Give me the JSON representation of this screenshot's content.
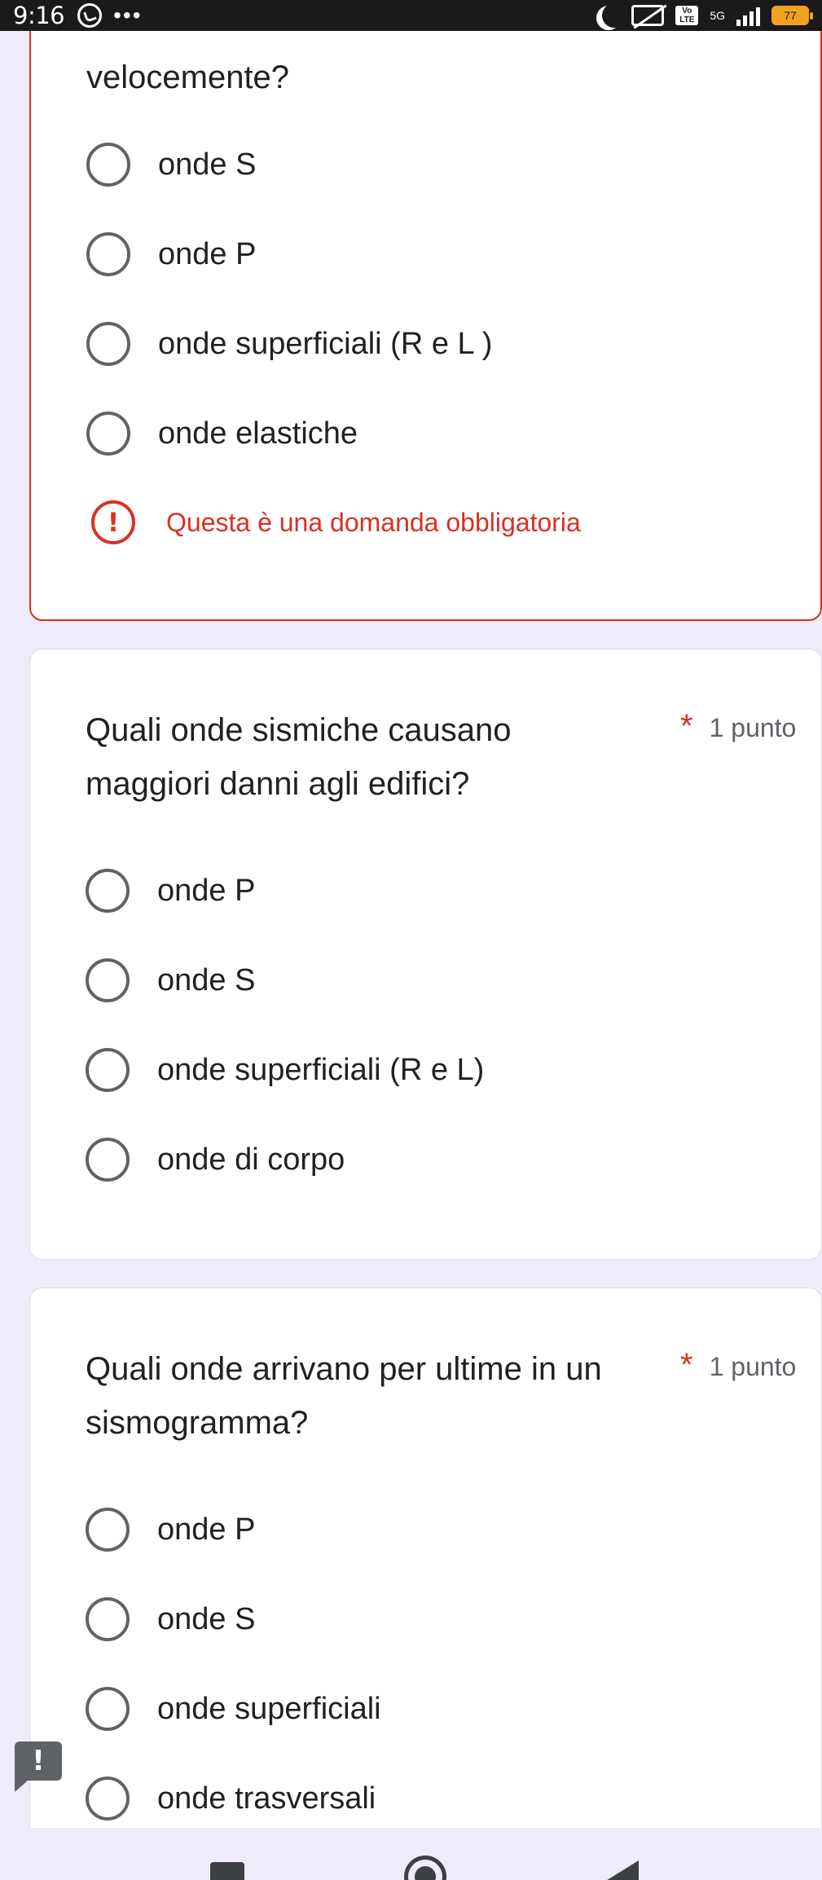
{
  "status_bar": {
    "time": "9:16",
    "overflow_dots": "•••",
    "network_badge": "Vo LTE",
    "network_type": "5G",
    "battery_level": "77",
    "icons": [
      "whatsapp-icon",
      "moon-icon",
      "vibrate-off-icon",
      "signal-icon",
      "battery-icon"
    ]
  },
  "questions": [
    {
      "title_partial": "velocemente?",
      "options": [
        "onde S",
        "onde P",
        "onde superficiali (R e L )",
        "onde elastiche"
      ],
      "error_message": "Questa è una domanda obbligatoria"
    },
    {
      "title": "Quali onde sismiche causano maggiori danni agli edifici?",
      "required_mark": "*",
      "points": "1 punto",
      "options": [
        "onde P",
        "onde S",
        "onde superficiali (R e L)",
        "onde di corpo"
      ]
    },
    {
      "title": "Quali onde arrivano per ultime in un sismogramma?",
      "required_mark": "*",
      "points": "1 punto",
      "options": [
        "onde P",
        "onde S",
        "onde superficiali",
        "onde trasversali"
      ]
    }
  ],
  "feedback_button": {
    "label": "!"
  },
  "colors": {
    "background": "#f0ebf8",
    "error": "#d93025",
    "card": "#ffffff",
    "text": "#202124"
  }
}
